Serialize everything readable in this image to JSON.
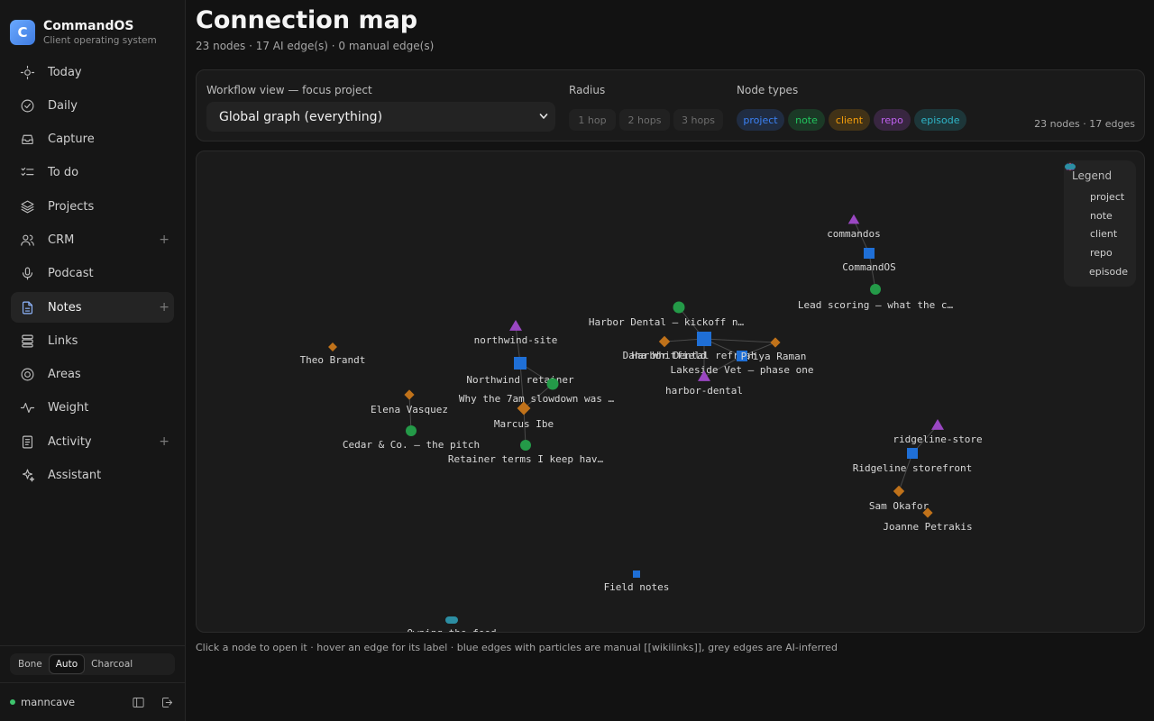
{
  "brand": {
    "logo_letter": "C",
    "name": "CommandOS",
    "subtitle": "Client operating system"
  },
  "nav": [
    {
      "label": "Today",
      "icon": "sun-icon",
      "plus": false,
      "active": false
    },
    {
      "label": "Daily",
      "icon": "check-circle-icon",
      "plus": false,
      "active": false
    },
    {
      "label": "Capture",
      "icon": "inbox-icon",
      "plus": false,
      "active": false
    },
    {
      "label": "To do",
      "icon": "list-check-icon",
      "plus": false,
      "active": false
    },
    {
      "label": "Projects",
      "icon": "layers-icon",
      "plus": false,
      "active": false
    },
    {
      "label": "CRM",
      "icon": "users-icon",
      "plus": true,
      "active": false
    },
    {
      "label": "Podcast",
      "icon": "mic-icon",
      "plus": false,
      "active": false
    },
    {
      "label": "Notes",
      "icon": "file-text-icon",
      "plus": true,
      "active": true
    },
    {
      "label": "Links",
      "icon": "database-icon",
      "plus": false,
      "active": false
    },
    {
      "label": "Areas",
      "icon": "target-icon",
      "plus": false,
      "active": false
    },
    {
      "label": "Weight",
      "icon": "activity-line-icon",
      "plus": false,
      "active": false
    },
    {
      "label": "Activity",
      "icon": "document-icon",
      "plus": true,
      "active": false
    },
    {
      "label": "Assistant",
      "icon": "sparkles-icon",
      "plus": false,
      "active": false
    }
  ],
  "nav_plus_glyph": "+",
  "theme": {
    "options": [
      "Bone",
      "Auto",
      "Charcoal"
    ],
    "selected": "Auto"
  },
  "user": {
    "name": "manncave"
  },
  "page": {
    "title": "Connection map",
    "subtitle": "23 nodes · 17 AI edge(s) · 0 manual edge(s)",
    "hint": "Click a node to open it · hover an edge for its label · blue edges with particles are manual [[wikilinks]], grey edges are AI-inferred"
  },
  "controls": {
    "workflow_label": "Workflow view — focus project",
    "workflow_value": "Global graph (everything)",
    "radius_label": "Radius",
    "radius_options": [
      "1 hop",
      "2 hops",
      "3 hops"
    ],
    "types_label": "Node types",
    "types": [
      {
        "label": "project",
        "color": "#3b82f6"
      },
      {
        "label": "note",
        "color": "#22c55e"
      },
      {
        "label": "client",
        "color": "#f59e0b"
      },
      {
        "label": "repo",
        "color": "#c061f0"
      },
      {
        "label": "episode",
        "color": "#2fb6c9"
      }
    ],
    "count": "23 nodes · 17 edges"
  },
  "legend": {
    "title": "Legend",
    "items": [
      {
        "label": "project",
        "shape": "square",
        "color": "#1f6fd6"
      },
      {
        "label": "note",
        "shape": "circle",
        "color": "#249a48"
      },
      {
        "label": "client",
        "shape": "diamond",
        "color": "#c0721a"
      },
      {
        "label": "repo",
        "shape": "triangle",
        "color": "#9a47c2"
      },
      {
        "label": "episode",
        "shape": "pill",
        "color": "#2c8ea3"
      }
    ]
  },
  "graph": {
    "nodes": [
      {
        "id": "commandos-repo",
        "label": "commandos",
        "type": "repo"
      },
      {
        "id": "commandos-project",
        "label": "CommandOS",
        "type": "project"
      },
      {
        "id": "lead-scoring",
        "label": "Lead scoring — what the c…",
        "type": "note"
      },
      {
        "id": "harbor-kickoff",
        "label": "Harbor Dental — kickoff n…",
        "type": "note"
      },
      {
        "id": "harbor-project",
        "label": "Harbor Dental refresh",
        "type": "project"
      },
      {
        "id": "dana",
        "label": "Dana Whitfield",
        "type": "client"
      },
      {
        "id": "lakeside",
        "label": "Lakeside Vet — phase one",
        "type": "project"
      },
      {
        "id": "priya",
        "label": "Priya Raman",
        "type": "client"
      },
      {
        "id": "harbor-repo",
        "label": "harbor-dental",
        "type": "repo"
      },
      {
        "id": "northwind-repo",
        "label": "northwind-site",
        "type": "repo"
      },
      {
        "id": "northwind-project",
        "label": "Northwind retainer",
        "type": "project"
      },
      {
        "id": "slowdown",
        "label": "Why the 7am slowdown was …",
        "type": "note"
      },
      {
        "id": "marcus",
        "label": "Marcus Ibe",
        "type": "client"
      },
      {
        "id": "retainer-terms",
        "label": "Retainer terms I keep hav…",
        "type": "note"
      },
      {
        "id": "theo",
        "label": "Theo Brandt",
        "type": "client"
      },
      {
        "id": "elena",
        "label": "Elena Vasquez",
        "type": "client"
      },
      {
        "id": "cedar",
        "label": "Cedar & Co. — the pitch",
        "type": "note"
      },
      {
        "id": "ridgeline-repo",
        "label": "ridgeline-store",
        "type": "repo"
      },
      {
        "id": "ridgeline-project",
        "label": "Ridgeline storefront",
        "type": "project"
      },
      {
        "id": "sam",
        "label": "Sam Okafor",
        "type": "client"
      },
      {
        "id": "joanne",
        "label": "Joanne Petrakis",
        "type": "client"
      },
      {
        "id": "field-notes",
        "label": "Field notes",
        "type": "project"
      },
      {
        "id": "owning-feed",
        "label": "Owning the feed",
        "type": "episode"
      }
    ],
    "edges": [
      [
        "commandos-repo",
        "commandos-project"
      ],
      [
        "commandos-project",
        "lead-scoring"
      ],
      [
        "harbor-kickoff",
        "harbor-project"
      ],
      [
        "dana",
        "harbor-project"
      ],
      [
        "harbor-project",
        "lakeside"
      ],
      [
        "harbor-project",
        "harbor-repo"
      ],
      [
        "harbor-project",
        "priya"
      ],
      [
        "lakeside",
        "priya"
      ],
      [
        "lakeside",
        "harbor-repo"
      ],
      [
        "northwind-repo",
        "northwind-project"
      ],
      [
        "northwind-project",
        "slowdown"
      ],
      [
        "northwind-project",
        "marcus"
      ],
      [
        "marcus",
        "retainer-terms"
      ],
      [
        "marcus",
        "slowdown"
      ],
      [
        "elena",
        "cedar"
      ],
      [
        "ridgeline-repo",
        "ridgeline-project"
      ],
      [
        "ridgeline-project",
        "sam"
      ]
    ]
  }
}
